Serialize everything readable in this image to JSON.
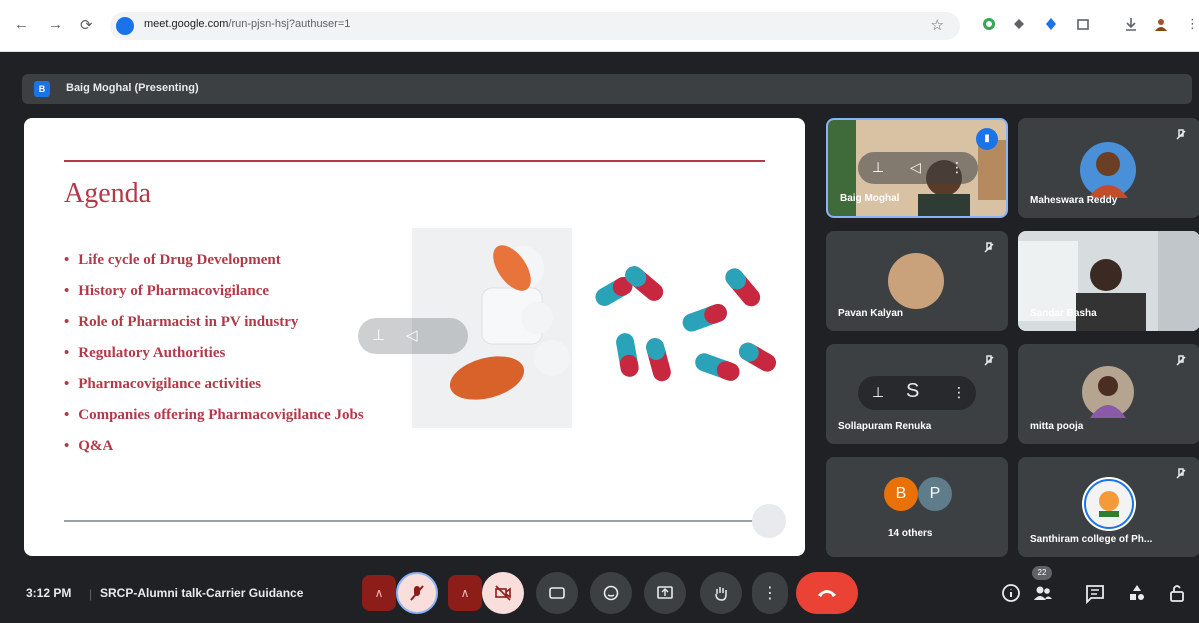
{
  "browser": {
    "url_host": "meet.google.com",
    "url_path": "/run-pjsn-hsj?authuser=1"
  },
  "meeting": {
    "presenter_badge": "B",
    "presenter_label": "Baig Moghal (Presenting)",
    "time": "3:12 PM",
    "title": "SRCP-Alumni talk-Carrier Guidance",
    "participants_count": "22"
  },
  "slide": {
    "title": "Agenda",
    "items": [
      "Life cycle of Drug Development",
      "History of Pharmacovigilance",
      "Role of Pharmacist in PV industry",
      "Regulatory Authorities",
      "Pharmacovigilance activities",
      "Companies offering Pharmacovigilance Jobs",
      "Q&A"
    ]
  },
  "tiles": {
    "t1": {
      "name": "Baig Moghal"
    },
    "t2": {
      "name": "Maheswara Reddy"
    },
    "t3": {
      "name": "Pavan Kalyan"
    },
    "t4": {
      "name": "Sandar Basha"
    },
    "t5": {
      "name": "Sollapuram Renuka",
      "initial": "S"
    },
    "t6": {
      "name": "mitta pooja"
    },
    "t7": {
      "name": "14 others",
      "avatar_a": "B",
      "avatar_b": "P"
    },
    "t8": {
      "name": "Santhiram college of Ph..."
    }
  },
  "colors": {
    "slide_accent": "#b23a48",
    "hangup": "#ea4335",
    "active_speaker": "#8ab4f8"
  }
}
